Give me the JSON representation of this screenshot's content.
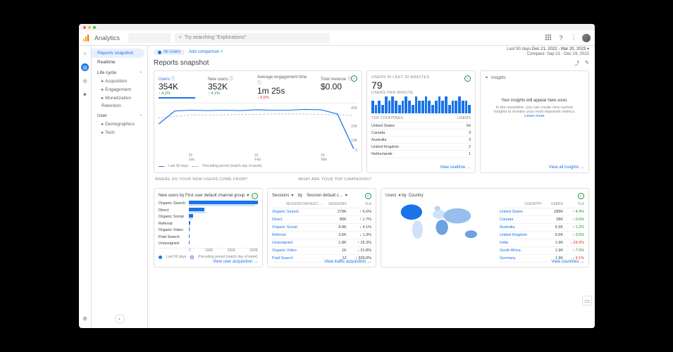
{
  "product": "Analytics",
  "search": {
    "placeholder": "Try searching \"Explorations\""
  },
  "dateRange": {
    "label": "Last 90 days",
    "primary": "Dec 21, 2022 - Mar 20, 2023",
    "compare": "Compare: Sep 21 - Dec 19, 2022"
  },
  "comparison": {
    "chip": "All Users",
    "add": "Add comparison"
  },
  "nav": {
    "items": [
      "Reports snapshot",
      "Realtime"
    ],
    "selectedIndex": 0,
    "sections": [
      {
        "title": "Life cycle",
        "open": true,
        "children": [
          "Acquisition",
          "Engagement",
          "Monetization",
          "Retention"
        ]
      },
      {
        "title": "User",
        "open": true,
        "children": [
          "Demographics",
          "Tech"
        ]
      }
    ]
  },
  "pageTitle": "Reports snapshot",
  "metricsCard": {
    "metrics": [
      {
        "label": "Users",
        "value": "354K",
        "change": "↑ 4.2%",
        "dir": "up",
        "active": true
      },
      {
        "label": "New users",
        "value": "352K",
        "change": "↑ 4.1%",
        "dir": "up"
      },
      {
        "label": "Average engagement time",
        "value": "1m 25s",
        "change": "↓ 0.6%",
        "dir": "dn"
      },
      {
        "label": "Total revenue",
        "value": "$0.00",
        "change": "",
        "dir": ""
      }
    ],
    "yticks": [
      "40K",
      "20K",
      "10K",
      "0"
    ],
    "xticks": [
      {
        "top": "01",
        "bot": "Jan"
      },
      {
        "top": "01",
        "bot": "Feb"
      },
      {
        "top": "01",
        "bot": "Mar"
      }
    ],
    "legend": [
      "Last 90 days",
      "Preceding period (match day of week)"
    ]
  },
  "realtime": {
    "title": "USERS IN LAST 30 MINUTES",
    "value": "79",
    "sub": "USERS PER MINUTE",
    "countriesHeader": [
      "TOP COUNTRIES",
      "USERS"
    ],
    "countries": [
      {
        "name": "United States",
        "users": "54"
      },
      {
        "name": "Canada",
        "users": "3"
      },
      {
        "name": "Australia",
        "users": "3"
      },
      {
        "name": "United Kingdom",
        "users": "2"
      },
      {
        "name": "Netherlands",
        "users": "1"
      }
    ],
    "link": "View realtime"
  },
  "insights": {
    "header": "Insights",
    "main": "Your insights will appear here soon.",
    "sub": "In the meantime, you can create new custom insights to monitor your most important metrics.",
    "learn": "Learn more",
    "link": "View all insights"
  },
  "sectionA": "WHERE DO YOUR NEW USERS COME FROM?",
  "sectionB": "WHAT ARE YOUR TOP CAMPAIGNS?",
  "acquisition": {
    "picker": "New users by First user default channel group",
    "rows": [
      {
        "cat": "Organic Search",
        "v": 100,
        "p": 96
      },
      {
        "cat": "Direct",
        "v": 22,
        "p": 24
      },
      {
        "cat": "Organic Social",
        "v": 6,
        "p": 5
      },
      {
        "cat": "Referral",
        "v": 2,
        "p": 2
      },
      {
        "cat": "Organic Video",
        "v": 1,
        "p": 1
      },
      {
        "cat": "Paid Search",
        "v": 0.5,
        "p": 0
      },
      {
        "cat": "Unassigned",
        "v": 0.5,
        "p": 0
      }
    ],
    "axis": [
      "0",
      "100K",
      "200K",
      "300K"
    ],
    "legend": [
      "Last 90 days",
      "Preceding period (match day of week)"
    ],
    "link": "View user acquisition"
  },
  "campaigns": {
    "picker1": "Sessions",
    "picker2": "by",
    "picker3": "Session default c…",
    "header": [
      "SESSION DEFAULT…  ",
      "SESSIONS",
      "% Δ"
    ],
    "rows": [
      {
        "c": "Organic Search",
        "v": "279K",
        "d": "↑ 5.6%"
      },
      {
        "c": "Direct",
        "v": "89K",
        "d": "↑ 1.7%"
      },
      {
        "c": "Organic Social",
        "v": "8.8K",
        "d": "↓ 4.1%"
      },
      {
        "c": "Referral",
        "v": "3.6K",
        "d": "↓ 1.3%"
      },
      {
        "c": "Unassigned",
        "v": "1.8K",
        "d": "↑ 16.3%"
      },
      {
        "c": "Organic Video",
        "v": "1K",
        "d": "↓ 31.8%"
      },
      {
        "c": "Paid Search",
        "v": "12",
        "d": "↑ 339.0%"
      }
    ],
    "link": "View traffic acquisition"
  },
  "usersByCountry": {
    "picker": "Users ▾ by Country",
    "header": [
      "COUNTRY",
      "USERS",
      "% Δ"
    ],
    "rows": [
      {
        "c": "United States",
        "v": "289K",
        "d": "↑ 4.9%"
      },
      {
        "c": "Canada",
        "v": "28K",
        "d": "↑ 0.6%"
      },
      {
        "c": "Australia",
        "v": "5.5K",
        "d": "↑ 1.2%"
      },
      {
        "c": "United Kingdom",
        "v": "5.6K",
        "d": "↑ 3.0%"
      },
      {
        "c": "India",
        "v": "1.9K",
        "d": "↓ 28.9%"
      },
      {
        "c": "South Africa",
        "v": "1.9K",
        "d": "↑ 7.5%"
      },
      {
        "c": "Germany",
        "v": "1.9K",
        "d": "↓ 4.1%"
      }
    ],
    "link": "View countries"
  },
  "chart_data": [
    {
      "type": "line",
      "title": "Users (Last 90 days vs preceding period)",
      "x": [
        "Jan 01",
        "Feb 01",
        "Mar 01"
      ],
      "ylim": [
        0,
        40000
      ],
      "series": [
        {
          "name": "Last 90 days",
          "values": [
            24000,
            34000,
            35000,
            34500,
            35000,
            34500,
            35500,
            35000,
            35000,
            36000,
            35500,
            32000,
            10000
          ]
        },
        {
          "name": "Preceding period",
          "values": [
            30000,
            32000,
            34000,
            33500,
            34000,
            34500,
            34500,
            35000,
            35000,
            35000,
            34500,
            34000,
            33000
          ]
        }
      ]
    },
    {
      "type": "bar",
      "title": "Users per minute (last 30 minutes)",
      "values": [
        3,
        2,
        3,
        2,
        4,
        3,
        4,
        3,
        2,
        3,
        4,
        3,
        2,
        4,
        3,
        3,
        4,
        3,
        2,
        3,
        4,
        3,
        4,
        2,
        3,
        3,
        4,
        3,
        3,
        2
      ]
    },
    {
      "type": "bar",
      "title": "New users by First user default channel group",
      "categories": [
        "Organic Search",
        "Direct",
        "Organic Social",
        "Referral",
        "Organic Video",
        "Paid Search",
        "Unassigned"
      ],
      "series": [
        {
          "name": "Last 90 days",
          "values": [
            290000,
            64000,
            17000,
            6000,
            3000,
            1500,
            1500
          ]
        },
        {
          "name": "Preceding period",
          "values": [
            278000,
            70000,
            15000,
            6000,
            3000,
            0,
            0
          ]
        }
      ],
      "xrange": [
        0,
        300000
      ]
    }
  ]
}
